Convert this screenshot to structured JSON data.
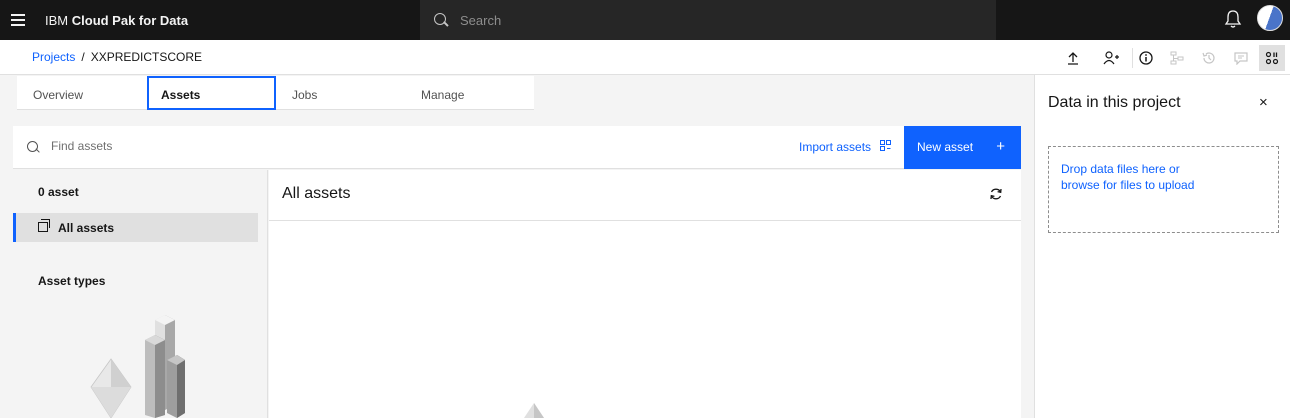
{
  "header": {
    "brand_prefix": "IBM",
    "brand_name": "Cloud Pak for Data",
    "search_placeholder": "Search",
    "icons": [
      "menu-icon",
      "search-icon",
      "notification-icon",
      "avatar"
    ]
  },
  "breadcrumb": {
    "root": "Projects",
    "separator": "/",
    "current": "XXPREDICTSCORE"
  },
  "toolbar_icons": [
    "upload-icon",
    "add-collaborator-icon",
    "info-icon",
    "flow-icon",
    "history-icon",
    "comment-icon",
    "data-panel-icon"
  ],
  "tabs": [
    {
      "label": "Overview",
      "active": false
    },
    {
      "label": "Assets",
      "active": true
    },
    {
      "label": "Jobs",
      "active": false
    },
    {
      "label": "Manage",
      "active": false
    }
  ],
  "asset_toolbar": {
    "find_placeholder": "Find assets",
    "import_label": "Import assets",
    "new_asset_label": "New asset",
    "new_asset_icon": "+"
  },
  "left_panel": {
    "count": "0 asset",
    "all_assets_label": "All assets",
    "asset_types_heading": "Asset types"
  },
  "main_panel": {
    "title": "All assets"
  },
  "right_panel": {
    "title": "Data in this project",
    "close_icon": "×",
    "drop_line1": "Drop data files here or",
    "drop_line2": "browse for files to upload"
  },
  "colors": {
    "header_bg": "#161616",
    "accent": "#0f62fe",
    "page_bg": "#f4f4f4"
  }
}
